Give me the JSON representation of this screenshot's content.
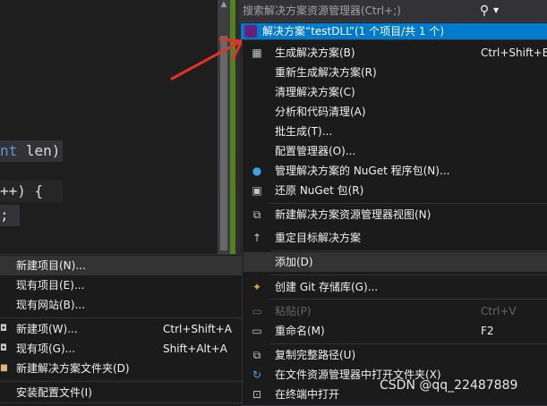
{
  "editor": {
    "code_line_1": "nt len)",
    "code_line_2": "++) {",
    "code_line_3": ";"
  },
  "solution_explorer": {
    "search_placeholder": "搜索解决方案资源管理器(Ctrl+;)",
    "search_icon": "search-icon",
    "selected_item": "解决方案“testDLL”(1 个项目/共 1 个)"
  },
  "context_menu": {
    "items": [
      {
        "label": "生成解决方案(B)",
        "shortcut": "Ctrl+Shift+B",
        "icon": "build-icon"
      },
      {
        "label": "重新生成解决方案(R)",
        "shortcut": ""
      },
      {
        "label": "清理解决方案(C)",
        "shortcut": ""
      },
      {
        "label": "分析和代码清理(A)",
        "shortcut": ""
      },
      {
        "label": "批生成(T)...",
        "shortcut": ""
      },
      {
        "label": "配置管理器(O)...",
        "shortcut": ""
      },
      {
        "label": "管理解决方案的 NuGet 程序包(N)...",
        "shortcut": "",
        "icon": "nuget-icon"
      },
      {
        "label": "还原 NuGet 包(R)",
        "shortcut": "",
        "icon": "restore-icon"
      },
      {
        "label": "新建解决方案资源管理器视图(N)",
        "shortcut": "",
        "icon": "new-view-icon"
      },
      {
        "label": "重定目标解决方案",
        "shortcut": "",
        "icon": "arrow-up-icon"
      },
      {
        "label": "添加(D)",
        "shortcut": ""
      },
      {
        "label": "创建 Git 存储库(G)...",
        "shortcut": "",
        "icon": "git-icon"
      },
      {
        "label": "粘贴(P)",
        "shortcut": "Ctrl+V",
        "icon": "paste-icon"
      },
      {
        "label": "重命名(M)",
        "shortcut": "F2",
        "icon": "rename-icon"
      },
      {
        "label": "复制完整路径(U)",
        "shortcut": "",
        "icon": "copy-path-icon"
      },
      {
        "label": "在文件资源管理器中打开文件夹(X)",
        "shortcut": "",
        "icon": "open-folder-icon"
      },
      {
        "label": "在终端中打开",
        "shortcut": "",
        "icon": "terminal-icon"
      }
    ]
  },
  "submenu": {
    "items": [
      {
        "label": "新建项目(N)...",
        "shortcut": ""
      },
      {
        "label": "现有项目(E)...",
        "shortcut": ""
      },
      {
        "label": "现有网站(B)...",
        "shortcut": ""
      },
      {
        "label": "新建项(W)...",
        "shortcut": "Ctrl+Shift+A",
        "icon": "new-item-icon"
      },
      {
        "label": "现有项(G)...",
        "shortcut": "Shift+Alt+A",
        "icon": "existing-item-icon"
      },
      {
        "label": "新建解决方案文件夹(D)",
        "shortcut": "",
        "icon": "folder-icon"
      },
      {
        "label": "安装配置文件(I)",
        "shortcut": ""
      }
    ]
  },
  "watermark": "CSDN @qq_22487889",
  "colors": {
    "accent": "#007acc",
    "menu_bg": "#1b1b1c",
    "arrow": "#e8302a"
  }
}
